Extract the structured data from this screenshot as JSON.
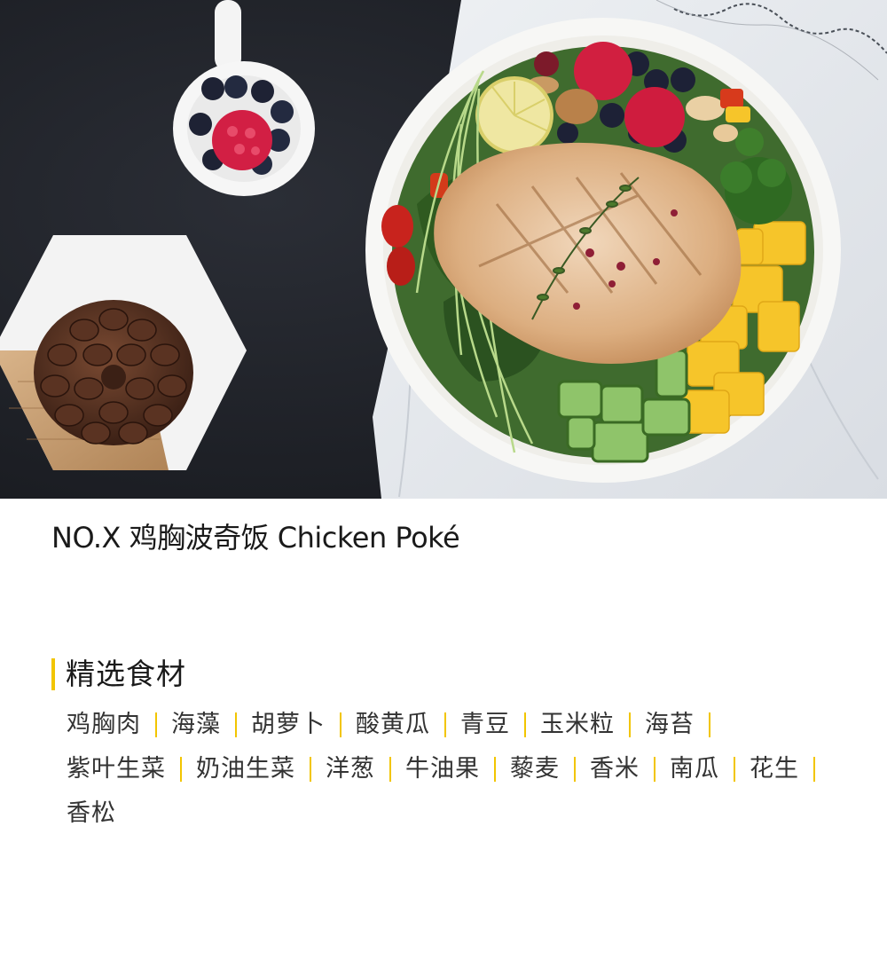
{
  "hero": {
    "icons": [
      "chicken-poke-bowl-photo",
      "berry-spoon",
      "pine-cone",
      "marble-wood-coaster",
      "linen-napkin"
    ]
  },
  "title": "NO.X 鸡胸波奇饭 Chicken Poké",
  "section": {
    "title": "精选食材"
  },
  "ingredients": [
    "鸡胸肉",
    "海藻",
    "胡萝卜",
    "酸黄瓜",
    "青豆",
    "玉米粒",
    "海苔",
    "紫叶生菜",
    "奶油生菜",
    "洋葱",
    "牛油果",
    "藜麦",
    "香米",
    "南瓜",
    "花生",
    "香松"
  ],
  "colors": {
    "accent": "#f2c500",
    "background": "#ffffff",
    "text": "#1a1a1a",
    "photo_backdrop": "#1f2127"
  }
}
